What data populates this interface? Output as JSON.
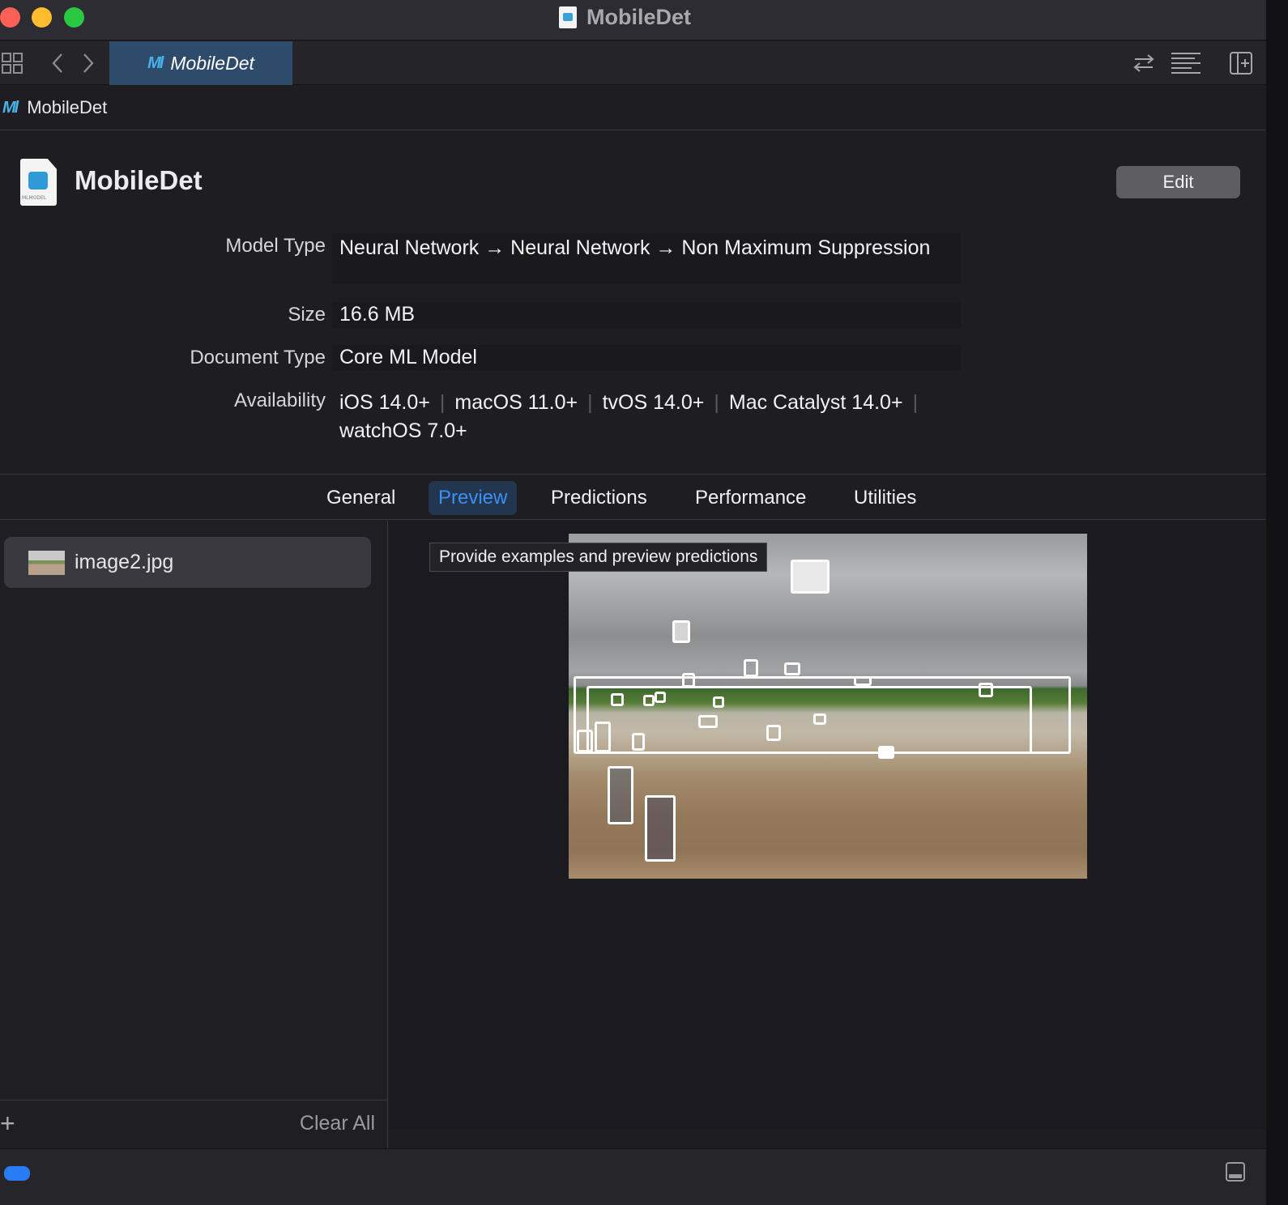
{
  "window": {
    "title": "MobileDet"
  },
  "tabbar": {
    "document_tab": "MobileDet"
  },
  "breadcrumb": {
    "label": "MobileDet"
  },
  "header": {
    "title": "MobileDet",
    "icon_caption": "MLMODEL",
    "edit_label": "Edit"
  },
  "info": {
    "model_type_label": "Model Type",
    "model_type_value": "Neural Network → Neural Network → Non Maximum Suppression",
    "size_label": "Size",
    "size_value": "16.6 MB",
    "doc_type_label": "Document Type",
    "doc_type_value": "Core ML Model",
    "availability_label": "Availability",
    "availability": [
      "iOS 14.0+",
      "macOS 11.0+",
      "tvOS 14.0+",
      "Mac Catalyst 14.0+",
      "watchOS 7.0+"
    ]
  },
  "tabs": [
    "General",
    "Preview",
    "Predictions",
    "Performance",
    "Utilities"
  ],
  "active_tab": "Preview",
  "sidebar": {
    "files": [
      {
        "name": "image2.jpg"
      }
    ],
    "clear_label": "Clear All",
    "add_label": "+"
  },
  "tooltip": "Provide examples and preview predictions",
  "icons": {
    "grid": "grid-icon",
    "back": "chevron-left-icon",
    "forward": "chevron-right-icon",
    "swap": "swap-arrows-icon",
    "lines": "editor-options-icon",
    "add_editor": "add-editor-icon"
  },
  "colors": {
    "accent": "#3d8ff3",
    "tab_highlight": "#2e4b6b",
    "close": "#fe5f57",
    "minimize": "#febc2e",
    "maximize": "#28c840"
  }
}
